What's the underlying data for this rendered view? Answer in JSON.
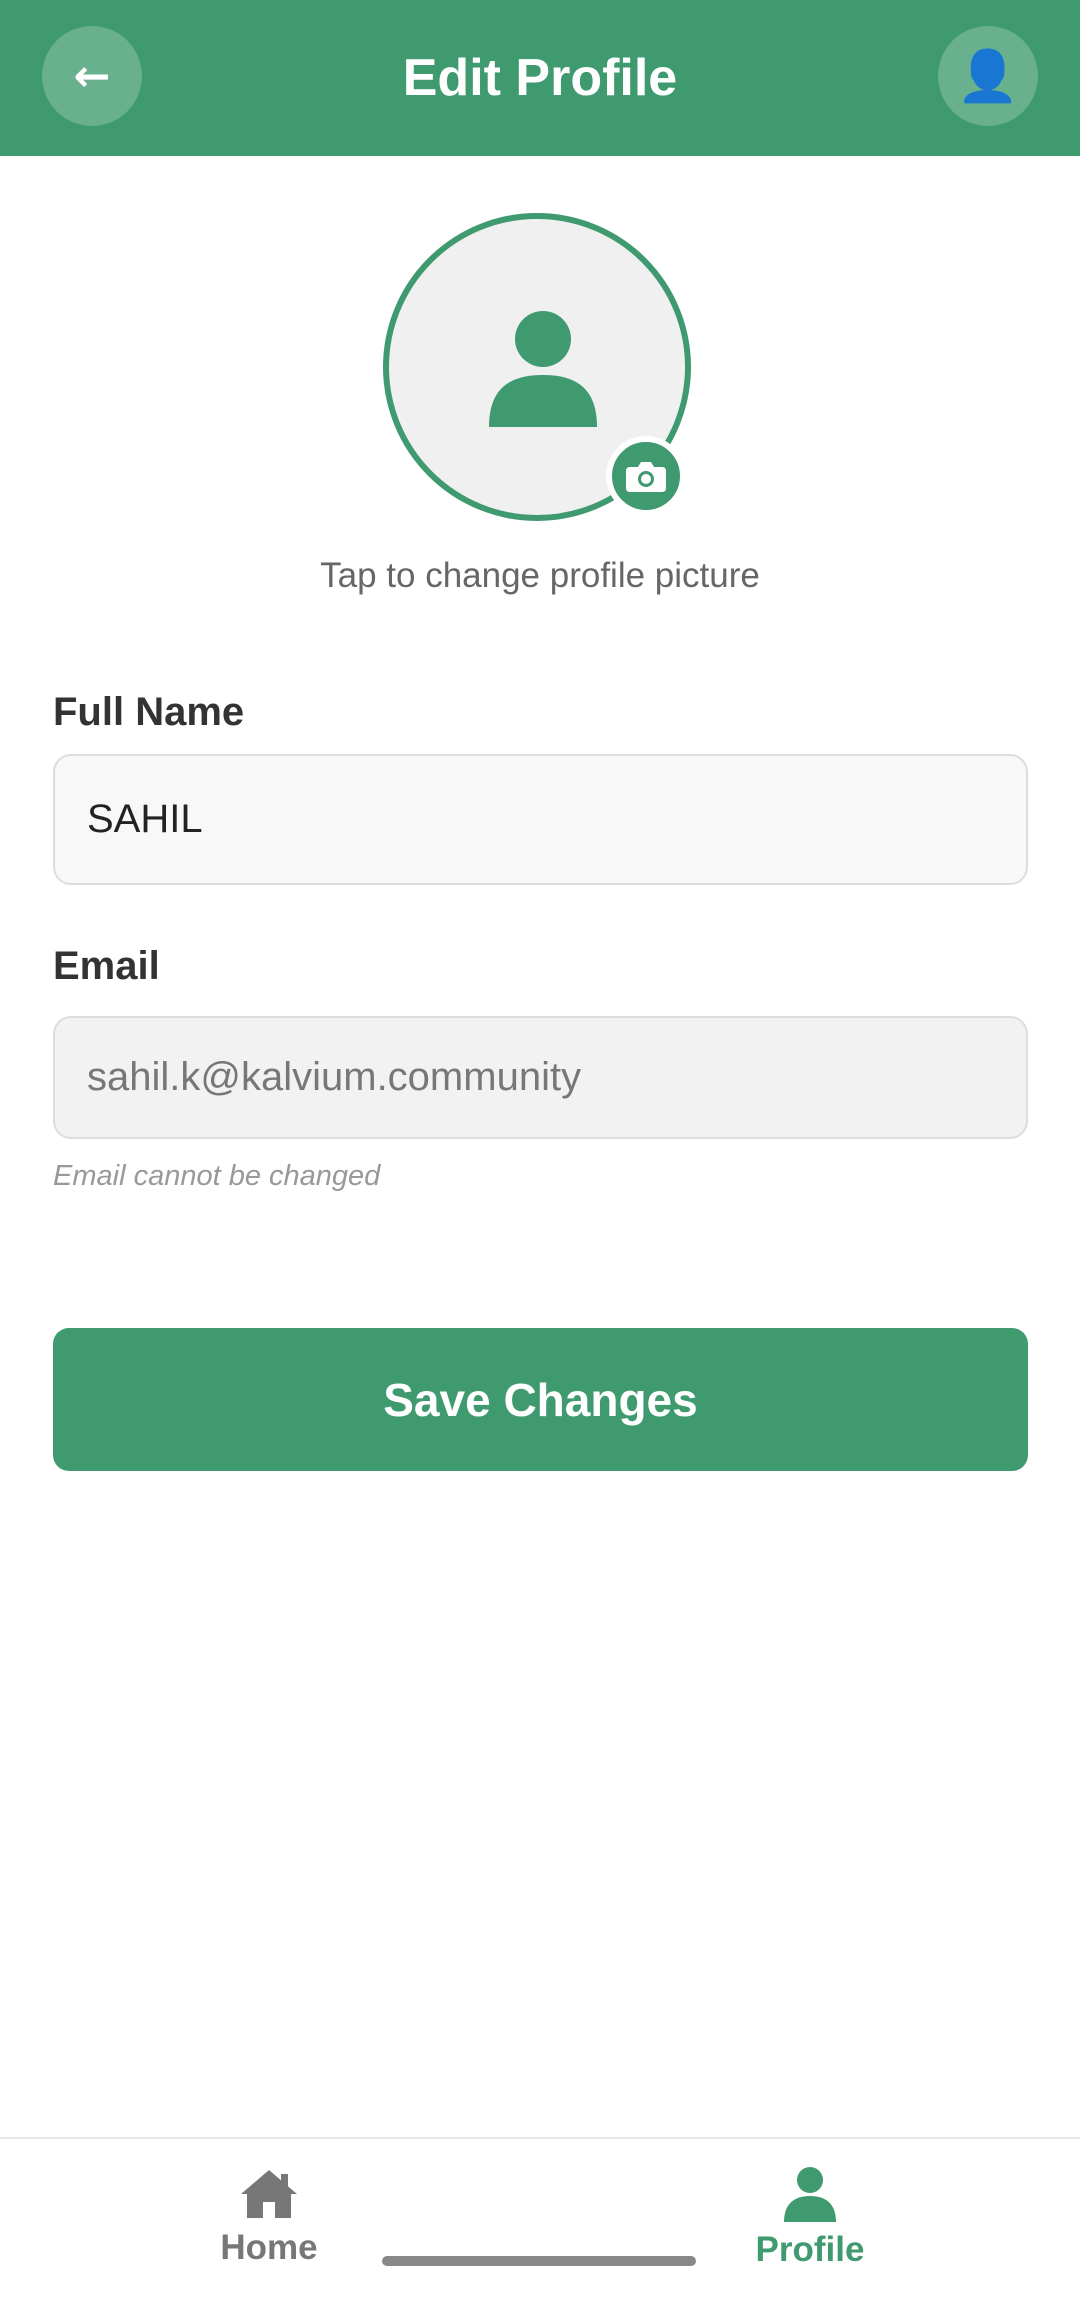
{
  "header": {
    "title": "Edit Profile",
    "back_icon": "←",
    "account_icon": "👤"
  },
  "avatar": {
    "hint": "Tap to change profile picture"
  },
  "form": {
    "name_label": "Full Name",
    "name_value": "SAHIL",
    "email_label": "Email",
    "email_value": "sahil.k@kalvium.community",
    "email_note": "Email cannot be changed"
  },
  "actions": {
    "save_label": "Save Changes"
  },
  "bottom_nav": {
    "items": [
      {
        "label": "Home",
        "icon": "home-icon",
        "active": false
      },
      {
        "label": "Profile",
        "icon": "person-icon",
        "active": true
      }
    ]
  },
  "colors": {
    "primary": "#3f9a70",
    "text_dark": "#333333",
    "text_muted": "#666666"
  }
}
